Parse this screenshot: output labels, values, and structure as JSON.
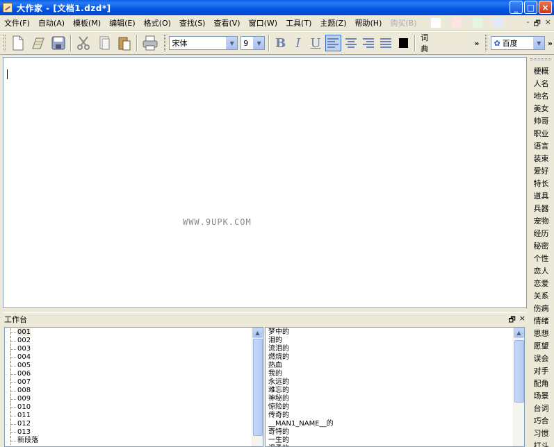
{
  "window": {
    "title": "大作家 - [文档1.dzd*]",
    "buttons": {
      "minimize": "_",
      "maximize": "□",
      "close": "×"
    }
  },
  "menubar": {
    "items": [
      {
        "label": "文件(F)"
      },
      {
        "label": "自动(A)"
      },
      {
        "label": "模板(M)"
      },
      {
        "label": "编辑(E)"
      },
      {
        "label": "格式(O)"
      },
      {
        "label": "查找(S)"
      },
      {
        "label": "查看(V)"
      },
      {
        "label": "窗口(W)"
      },
      {
        "label": "工具(T)"
      },
      {
        "label": "主题(Z)"
      },
      {
        "label": "帮助(H)"
      },
      {
        "label": "购买(B)",
        "disabled": true
      }
    ],
    "swatches": [
      "#ffffff",
      "#fde3e3",
      "#e3f5e3",
      "#e3e8fb"
    ],
    "mdi": {
      "minimize": "-",
      "restore": "🗗",
      "close": "×"
    }
  },
  "toolbar": {
    "font_name": "宋体",
    "font_size": "9",
    "dict_label": "词典",
    "more": "»",
    "search_engine": "百度",
    "fmt": {
      "bold": "B",
      "italic": "I",
      "underline": "U"
    },
    "text_color": "#000000"
  },
  "editor": {
    "watermark": "WWW.9UPK.COM"
  },
  "sidebar": {
    "items": [
      "梗概",
      "人名",
      "地名",
      "美女",
      "帅哥",
      "职业",
      "语言",
      "装束",
      "爱好",
      "特长",
      "道具",
      "兵器",
      "宠物",
      "经历",
      "秘密",
      "个性",
      "恋人",
      "恋爱",
      "关系",
      "伤病",
      "情绪",
      "思想",
      "愿望",
      "误会",
      "对手",
      "配角",
      "场景",
      "台词",
      "巧合",
      "习惯",
      "打斗"
    ]
  },
  "workbench": {
    "title": "工作台",
    "buttons": {
      "float": "🗗",
      "close": "×"
    },
    "tree": [
      "001",
      "002",
      "003",
      "004",
      "005",
      "006",
      "007",
      "008",
      "009",
      "010",
      "011",
      "012",
      "013",
      "新段落"
    ],
    "words": [
      "梦中的",
      "泪的",
      "流泪的",
      "燃烧的",
      "热血",
      "我的",
      "永远的",
      "难忘的",
      "神秘的",
      "惊险的",
      "传奇的",
      "__MAN1_NAME__的",
      "奇特的",
      "一生的",
      "温柔的"
    ]
  }
}
